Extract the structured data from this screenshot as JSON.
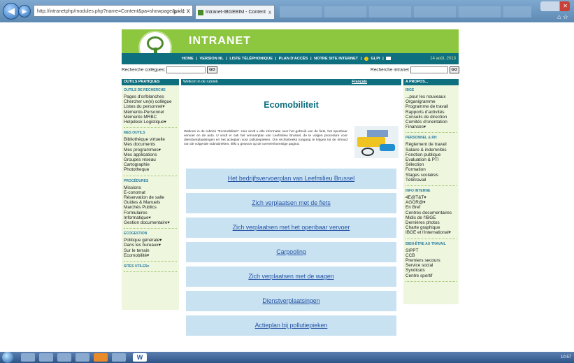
{
  "browser": {
    "address": "http://intranetphp/modules.php?name=Content&pa=showpage&pid",
    "address_controls": "ρ - ¢ X",
    "tab_title": "Intranet-IBGEBIM - Content",
    "tab_close": "x"
  },
  "header": {
    "title": "INTRANET",
    "nav": [
      "HOME",
      "VERSION NL",
      "LISTE TÉLÉPHONIQUE",
      "PLAN D'ACCÈS",
      "NOTRE SITE INTERNET",
      "GLPI"
    ],
    "separator": "|",
    "date": "14 août, 2013"
  },
  "search": {
    "colleagues_label": "Recherche collègues:",
    "intranet_label": "Recherche intranet",
    "go_label": "GO"
  },
  "left": {
    "title": "OUTILS PRATIQUES",
    "sections": [
      {
        "head": "OUTILS DE RECHERCHE",
        "items": [
          "Pages d'or/blanches",
          "Chercher un(e) collègue",
          "Listes du personnel▾",
          "Mémento-Personnel",
          "Mémento MRBC",
          "Helpdesk Logistique▾"
        ]
      },
      {
        "head": "MES OUTILS",
        "items": [
          "Bibliothèque virtuelle",
          "Mes documents",
          "Mes programmes▾",
          "Mes applications",
          "Groupes réseau",
          "Cartographie",
          "Phototheque"
        ]
      },
      {
        "head": "PROCÉDURES",
        "items": [
          "Missions",
          "E-conomat",
          "Réservation de salle",
          "Guides & Manuels",
          "Marchés Publics",
          "Formulaires",
          "Informatique▾",
          "Gestion documentaire▾"
        ]
      },
      {
        "head": "ECOGESTION",
        "items": [
          "Politique générale▾",
          "Dans les bureaux▾",
          "Sur le terrain",
          "Ecomobilité▾"
        ]
      },
      {
        "head": "SITES UTILES▾",
        "items": []
      }
    ]
  },
  "right": {
    "title": "A PROPOS...",
    "sections": [
      {
        "head": "IBGE",
        "items": [
          "...pour les nouveaux",
          "Organigramme",
          "Programme de travail",
          "Rapports d'activités",
          "Conseils de direction",
          "Comités d'orientation",
          "Finances▾"
        ]
      },
      {
        "head": "PERSONNEL & RH",
        "items": [
          "Règlement de travail",
          "Salaire & indemnités",
          "Fonction publique",
          "Evaluation & PTI",
          "Sélection",
          "Formation",
          "Stages scolaires",
          "Télétravail"
        ]
      },
      {
        "head": "INFO INTERNE",
        "items": [
          "4E@T&T▾",
          "AGOR@▾",
          "En Bref",
          "Centres documentaires",
          "Midis de l'IBGE",
          "Dernières photos",
          "Charte graphique",
          "IBGE et l'international▾"
        ]
      },
      {
        "head": "BIEN-ÊTRE AU TRAVAIL",
        "items": [
          "SIPPT",
          "CCB",
          "Premiers secours",
          "Service social",
          "Syndicats",
          "Centre sportif"
        ]
      }
    ]
  },
  "main": {
    "welcome": "Welkom in de rubriek",
    "french_link": "Français",
    "title": "Ecomobiliteit",
    "intro": "Welkom in de rubriek \"Ecomobiliteit\". Hier vindt u alle informatie over het gebruik van de fiets, het openbaar vervoer en de auto. U vindt er ook het vervoerplan van Leefmilieu Brussel, de te volgen procedure voor dienstverplaatsingen en het actieplan voor pollutiepieken. Om rechtstreeks toegang te krijgen tot de inhoud van de volgende subrubrieken, klikt u gewoon op de overeenkomstige pagina.",
    "links": [
      "Het bedrijfsvervoerplan van Leefmilieu Brussel",
      "Zich verplaatsen met de fiets",
      "Zich verplaatsen met het openbaar vervoer",
      "Carpooling",
      "Zich verplaatsen met de wagen",
      "Dienstverplaatsingen",
      "Actieplan bij pollutiepieken"
    ]
  },
  "taskbar": {
    "clock": "10:57"
  }
}
